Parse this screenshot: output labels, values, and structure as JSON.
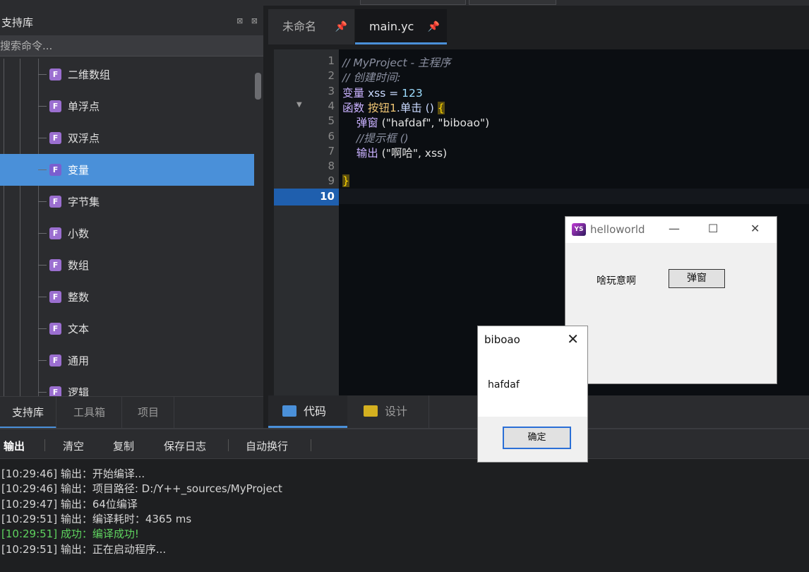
{
  "left_panel": {
    "title": "支持库",
    "header_icons": "⊠ ⊠",
    "search_placeholder": "搜索命令...",
    "items": [
      {
        "label": "二维数组",
        "badge": "F"
      },
      {
        "label": "单浮点",
        "badge": "F"
      },
      {
        "label": "双浮点",
        "badge": "F"
      },
      {
        "label": "变量",
        "badge": "F",
        "selected": true
      },
      {
        "label": "字节集",
        "badge": "F"
      },
      {
        "label": "小数",
        "badge": "F"
      },
      {
        "label": "数组",
        "badge": "F"
      },
      {
        "label": "整数",
        "badge": "F"
      },
      {
        "label": "文本",
        "badge": "F"
      },
      {
        "label": "通用",
        "badge": "F"
      },
      {
        "label": "逻辑",
        "badge": "F"
      }
    ],
    "tabs": [
      "支持库",
      "工具箱",
      "项目"
    ]
  },
  "editor": {
    "tabs": [
      {
        "label": "未命名",
        "pin": "📌"
      },
      {
        "label": "main.yc",
        "pin": "📌"
      }
    ],
    "lines": [
      {
        "n": "1",
        "text": "// MyProject - 主程序"
      },
      {
        "n": "2",
        "text": "// 创建时间:"
      },
      {
        "n": "3",
        "kw": "变量",
        "id": " xss = ",
        "num": "123"
      },
      {
        "n": "4",
        "kw": "函数",
        "fn": " 按钮1",
        "id": ".单击 () ",
        "brace": "{"
      },
      {
        "n": "5",
        "kw": "    弹窗",
        "str": " (\"hafdaf\", \"biboao\")"
      },
      {
        "n": "6",
        "text": "    //提示框 ()"
      },
      {
        "n": "7",
        "kw": "    输出",
        "str": " (\"啊哈\", xss)"
      },
      {
        "n": "8"
      },
      {
        "n": "9",
        "brace": "}"
      },
      {
        "n": "10"
      }
    ],
    "bottom_tabs": [
      "代码",
      "设计"
    ]
  },
  "output": {
    "toolbar": {
      "title": "输出",
      "clear": "清空",
      "copy": "复制",
      "save_log": "保存日志",
      "wrap": "自动换行"
    },
    "logs": [
      {
        "text": "[10:29:46] 输出：开始编译...",
        "ok": false
      },
      {
        "text": "[10:29:46] 输出：项目路径: D:/Y++_sources/MyProject",
        "ok": false
      },
      {
        "text": "[10:29:47] 输出：64位编译",
        "ok": false
      },
      {
        "text": "[10:29:51] 输出：编译耗时：4365 ms",
        "ok": false
      },
      {
        "text": "[10:29:51] 成功：编译成功!",
        "ok": true
      },
      {
        "text": "[10:29:51] 输出：正在启动程序...",
        "ok": false
      }
    ]
  },
  "helloworld_window": {
    "logo": "YS",
    "title": "helloworld",
    "minimize": "—",
    "maximize": "☐",
    "close": "✕",
    "label": "啥玩意啊",
    "button": "弹窗"
  },
  "message_box": {
    "title": "biboao",
    "close": "✕",
    "text": "hafdaf",
    "ok_button": "确定"
  },
  "colors": {
    "accent": "#4a90d9",
    "badge": "#9b6fd0",
    "success": "#5fd35f"
  }
}
